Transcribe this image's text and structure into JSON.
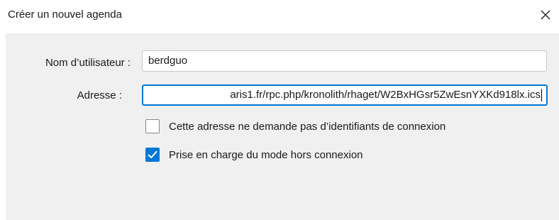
{
  "dialog": {
    "title": "Créer un nouvel agenda",
    "close_icon": "close-icon"
  },
  "form": {
    "username_label": "Nom d’utilisateur :",
    "username_value": "berdguo",
    "address_label": "Adresse :",
    "address_value_visible": "aris1.fr/rpc.php/kronolith/rhaget/W2BxHGsr5ZwEsnYXKd918lx.ics",
    "no_credentials_label": "Cette adresse ne demande pas d’identifiants de connexion",
    "no_credentials_checked": false,
    "offline_label": "Prise en charge du mode hors connexion",
    "offline_checked": true
  },
  "colors": {
    "accent": "#0078d7",
    "panel_bg": "#f0f0f0"
  }
}
